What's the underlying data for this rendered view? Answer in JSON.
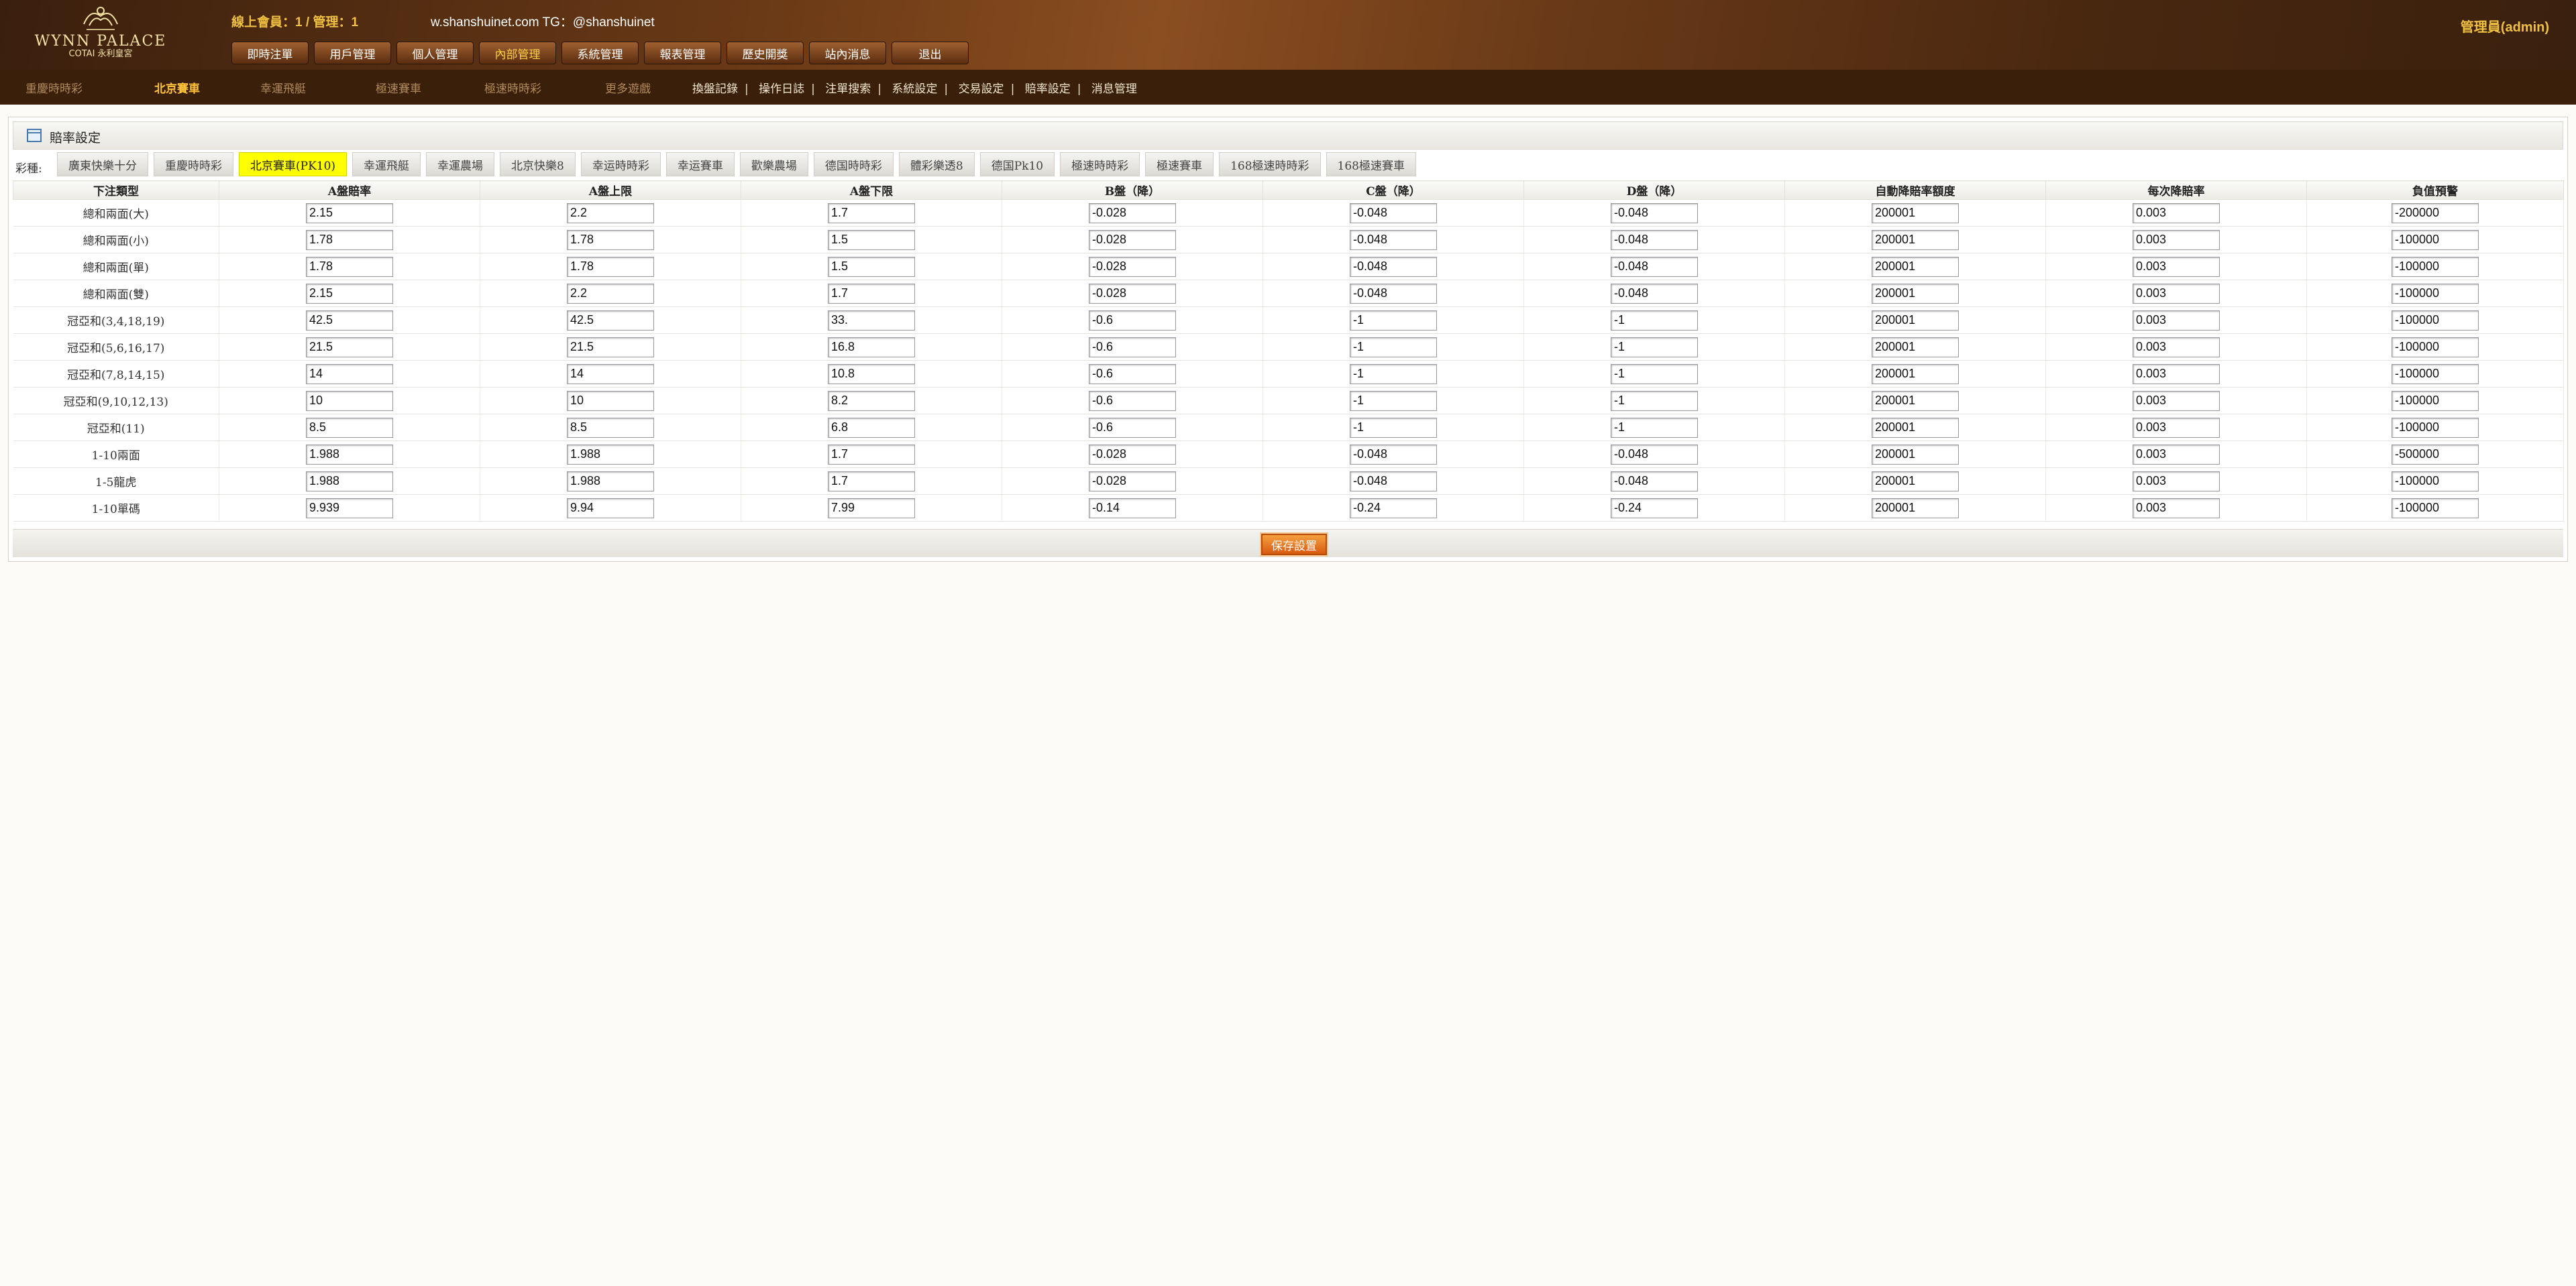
{
  "header": {
    "logo_name": "WYNN PALACE",
    "logo_small": "COTAI",
    "logo_cn": "永利皇宮",
    "status": {
      "online_label": "線上會員",
      "online_count": "1",
      "admin_label": "管理",
      "admin_count": "1"
    },
    "domain_text": "w.shanshuinet.com TG：@shanshuinet",
    "admin_user": "管理員(admin)",
    "nav": [
      "即時注單",
      "用戶管理",
      "個人管理",
      "內部管理",
      "系統管理",
      "報表管理",
      "歷史開獎",
      "站內消息",
      "退出"
    ],
    "nav_active": "內部管理"
  },
  "subnav": {
    "games": [
      "重慶時時彩",
      "北京賽車",
      "幸運飛艇",
      "極速賽車",
      "極速時時彩",
      "更多遊戲"
    ],
    "active_game": "北京賽車",
    "links": [
      "換盤記錄",
      "操作日誌",
      "注單搜索",
      "系統設定",
      "交易設定",
      "賠率設定",
      "消息管理"
    ]
  },
  "panel": {
    "title": "賠率設定",
    "tabs_label": "彩種:",
    "tabs": [
      "廣東快樂十分",
      "重慶時時彩",
      "北京賽車(PK10)",
      "幸運飛艇",
      "幸運農場",
      "北京快樂8",
      "幸运時時彩",
      "幸运賽車",
      "歡樂農場",
      "德国時時彩",
      "體彩樂透8",
      "德国Pk10",
      "極速時時彩",
      "極速賽車",
      "168極速時時彩",
      "168極速賽車"
    ],
    "active_tab": "北京賽車(PK10)",
    "columns": [
      "下注類型",
      "A盤賠率",
      "A盤上限",
      "A盤下限",
      "B盤（降）",
      "C盤（降）",
      "D盤（降）",
      "自動降賠率額度",
      "每次降賠率",
      "負值預警"
    ],
    "rows": [
      {
        "type": "總和兩面(大)",
        "values": [
          "2.15",
          "2.2",
          "1.7",
          "-0.028",
          "-0.048",
          "-0.048",
          "200001",
          "0.003",
          "-200000"
        ]
      },
      {
        "type": "總和兩面(小)",
        "values": [
          "1.78",
          "1.78",
          "1.5",
          "-0.028",
          "-0.048",
          "-0.048",
          "200001",
          "0.003",
          "-100000"
        ]
      },
      {
        "type": "總和兩面(單)",
        "values": [
          "1.78",
          "1.78",
          "1.5",
          "-0.028",
          "-0.048",
          "-0.048",
          "200001",
          "0.003",
          "-100000"
        ]
      },
      {
        "type": "總和兩面(雙)",
        "values": [
          "2.15",
          "2.2",
          "1.7",
          "-0.028",
          "-0.048",
          "-0.048",
          "200001",
          "0.003",
          "-100000"
        ]
      },
      {
        "type": "冠亞和(3,4,18,19)",
        "values": [
          "42.5",
          "42.5",
          "33.",
          "-0.6",
          "-1",
          "-1",
          "200001",
          "0.003",
          "-100000"
        ]
      },
      {
        "type": "冠亞和(5,6,16,17)",
        "values": [
          "21.5",
          "21.5",
          "16.8",
          "-0.6",
          "-1",
          "-1",
          "200001",
          "0.003",
          "-100000"
        ]
      },
      {
        "type": "冠亞和(7,8,14,15)",
        "values": [
          "14",
          "14",
          "10.8",
          "-0.6",
          "-1",
          "-1",
          "200001",
          "0.003",
          "-100000"
        ]
      },
      {
        "type": "冠亞和(9,10,12,13)",
        "values": [
          "10",
          "10",
          "8.2",
          "-0.6",
          "-1",
          "-1",
          "200001",
          "0.003",
          "-100000"
        ]
      },
      {
        "type": "冠亞和(11)",
        "values": [
          "8.5",
          "8.5",
          "6.8",
          "-0.6",
          "-1",
          "-1",
          "200001",
          "0.003",
          "-100000"
        ]
      },
      {
        "type": "1-10兩面",
        "values": [
          "1.988",
          "1.988",
          "1.7",
          "-0.028",
          "-0.048",
          "-0.048",
          "200001",
          "0.003",
          "-500000"
        ]
      },
      {
        "type": "1-5龍虎",
        "values": [
          "1.988",
          "1.988",
          "1.7",
          "-0.028",
          "-0.048",
          "-0.048",
          "200001",
          "0.003",
          "-100000"
        ]
      },
      {
        "type": "1-10單碼",
        "values": [
          "9.939",
          "9.94",
          "7.99",
          "-0.14",
          "-0.24",
          "-0.24",
          "200001",
          "0.003",
          "-100000"
        ]
      }
    ],
    "save_label": "保存設置"
  },
  "colors": {
    "accent": "#f0c040",
    "active_tab": "#ffff00",
    "save_button": "#e87a20",
    "header_bg": "#6b3a16"
  }
}
